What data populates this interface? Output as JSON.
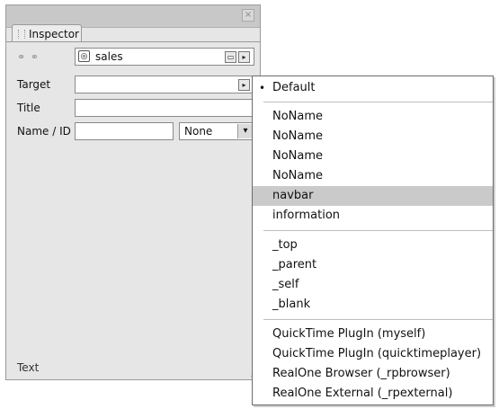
{
  "panel": {
    "close_glyph": "×",
    "tab_label": "Inspector",
    "link_icons": "⚭ ⚭",
    "path_icon": "◎",
    "path_value": "sales",
    "folder_glyph": "▭",
    "arrow_glyph": "▸",
    "target_label": "Target",
    "title_label": "Title",
    "nameid_label": "Name / ID",
    "nameid_select_value": "None",
    "dropdown_glyph": "▾",
    "footer_text": "Text"
  },
  "menu": {
    "bullet": "•",
    "group1": [
      "Default"
    ],
    "group2": [
      "NoName",
      "NoName",
      "NoName",
      "NoName",
      "navbar",
      "information"
    ],
    "group3": [
      "_top",
      "_parent",
      "_self",
      "_blank"
    ],
    "group4": [
      "QuickTime PlugIn (myself)",
      "QuickTime PlugIn (quicktimeplayer)",
      "RealOne Browser (_rpbrowser)",
      "RealOne External (_rpexternal)"
    ],
    "selected_item": "navbar"
  }
}
